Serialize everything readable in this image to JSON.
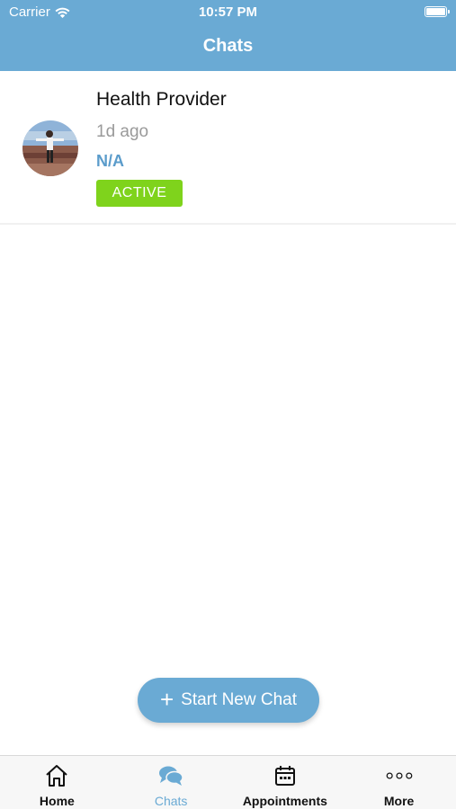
{
  "status_bar": {
    "carrier": "Carrier",
    "time": "10:57 PM"
  },
  "header": {
    "title": "Chats"
  },
  "chats": [
    {
      "name": "Health Provider",
      "time": "1d ago",
      "subtitle": "N/A",
      "status": "ACTIVE"
    }
  ],
  "new_chat_button": {
    "label": "Start New Chat"
  },
  "tabs": [
    {
      "label": "Home",
      "icon": "home-icon"
    },
    {
      "label": "Chats",
      "icon": "chat-bubbles-icon",
      "active": true
    },
    {
      "label": "Appointments",
      "icon": "calendar-icon"
    },
    {
      "label": "More",
      "icon": "more-dots-icon"
    }
  ],
  "colors": {
    "accent": "#6aaad4",
    "active_badge": "#7fd31c",
    "link": "#5b9ccb"
  }
}
